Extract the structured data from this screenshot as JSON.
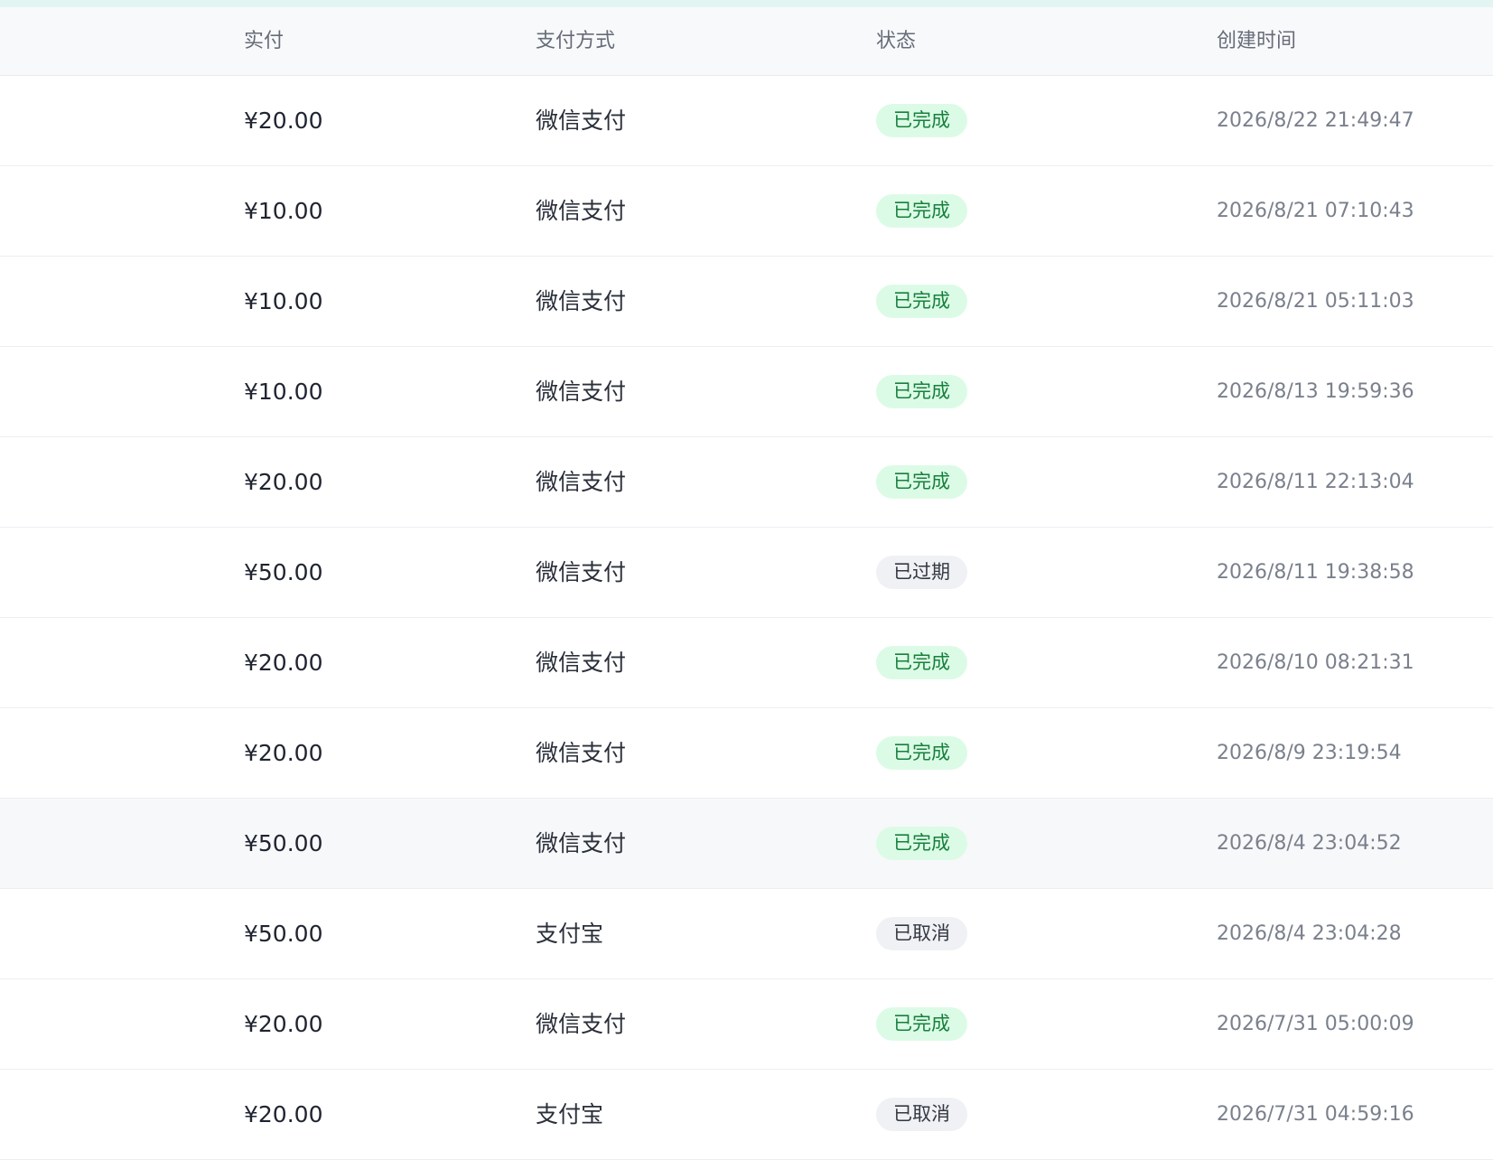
{
  "table": {
    "columns": {
      "amount": "实付",
      "method": "支付方式",
      "status": "状态",
      "created": "创建时间"
    },
    "status_colors": {
      "done_bg": "#dcfbe6",
      "done_text": "#16803c",
      "neutral_bg": "#f0f1f4",
      "neutral_text": "#333843"
    },
    "rows": [
      {
        "amount": "¥20.00",
        "method": "微信支付",
        "status": "已完成",
        "status_type": "done",
        "created": "2026/8/22 21:49:47"
      },
      {
        "amount": "¥10.00",
        "method": "微信支付",
        "status": "已完成",
        "status_type": "done",
        "created": "2026/8/21 07:10:43"
      },
      {
        "amount": "¥10.00",
        "method": "微信支付",
        "status": "已完成",
        "status_type": "done",
        "created": "2026/8/21 05:11:03"
      },
      {
        "amount": "¥10.00",
        "method": "微信支付",
        "status": "已完成",
        "status_type": "done",
        "created": "2026/8/13 19:59:36"
      },
      {
        "amount": "¥20.00",
        "method": "微信支付",
        "status": "已完成",
        "status_type": "done",
        "created": "2026/8/11 22:13:04"
      },
      {
        "amount": "¥50.00",
        "method": "微信支付",
        "status": "已过期",
        "status_type": "neutral",
        "created": "2026/8/11 19:38:58"
      },
      {
        "amount": "¥20.00",
        "method": "微信支付",
        "status": "已完成",
        "status_type": "done",
        "created": "2026/8/10 08:21:31"
      },
      {
        "amount": "¥20.00",
        "method": "微信支付",
        "status": "已完成",
        "status_type": "done",
        "created": "2026/8/9 23:19:54"
      },
      {
        "amount": "¥50.00",
        "method": "微信支付",
        "status": "已完成",
        "status_type": "done",
        "created": "2026/8/4 23:04:52",
        "hovered": true
      },
      {
        "amount": "¥50.00",
        "method": "支付宝",
        "status": "已取消",
        "status_type": "neutral",
        "created": "2026/8/4 23:04:28"
      },
      {
        "amount": "¥20.00",
        "method": "微信支付",
        "status": "已完成",
        "status_type": "done",
        "created": "2026/7/31 05:00:09"
      },
      {
        "amount": "¥20.00",
        "method": "支付宝",
        "status": "已取消",
        "status_type": "neutral",
        "created": "2026/7/31 04:59:16"
      }
    ]
  }
}
